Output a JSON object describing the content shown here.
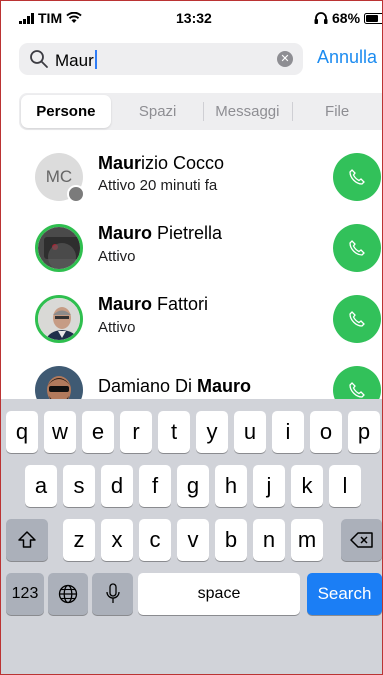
{
  "status_bar": {
    "carrier": "TIM",
    "time": "13:32",
    "battery": "68%"
  },
  "search": {
    "query": "Maur",
    "cancel_label": "Annulla"
  },
  "tabs": [
    "Persone",
    "Spazi",
    "Messaggi",
    "File"
  ],
  "contacts": [
    {
      "initials": "MC",
      "name_bold": "Maur",
      "name_rest": "izio Cocco",
      "status": "Attivo 20 minuti fa"
    },
    {
      "name_bold": "Mauro",
      "name_rest": " Pietrella",
      "status": "Attivo"
    },
    {
      "name_bold": "Mauro",
      "name_rest": " Fattori",
      "status": "Attivo"
    },
    {
      "name_prefix": "Damiano Di ",
      "name_bold": "Mauro"
    }
  ],
  "keyboard": {
    "row1": [
      "q",
      "w",
      "e",
      "r",
      "t",
      "y",
      "u",
      "i",
      "o",
      "p"
    ],
    "row2": [
      "a",
      "s",
      "d",
      "f",
      "g",
      "h",
      "j",
      "k",
      "l"
    ],
    "row3": [
      "z",
      "x",
      "c",
      "v",
      "b",
      "n",
      "m"
    ],
    "numbers_label": "123",
    "space_label": "space",
    "search_label": "Search"
  },
  "colors": {
    "accent": "#1d8cf0",
    "call_green": "#32c15a",
    "keyboard_bg": "#d1d3d9"
  }
}
